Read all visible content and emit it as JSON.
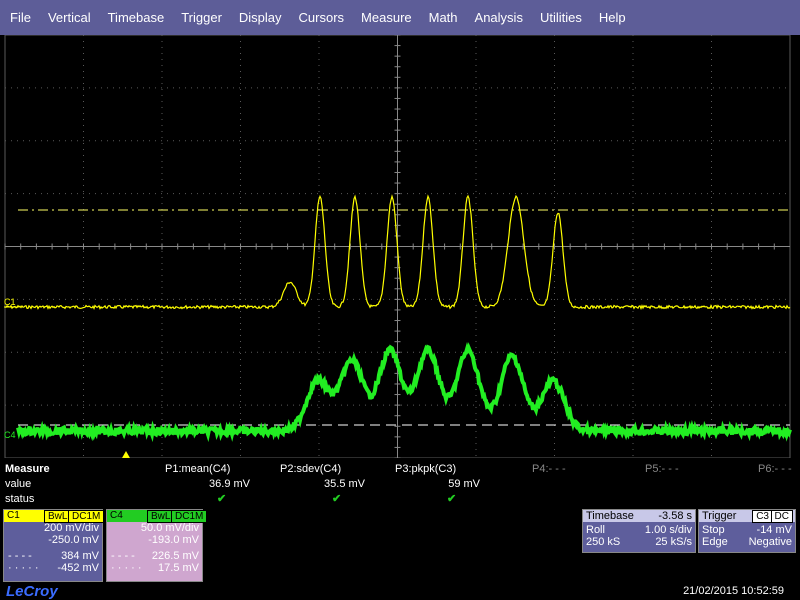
{
  "menu": [
    "File",
    "Vertical",
    "Timebase",
    "Trigger",
    "Display",
    "Cursors",
    "Measure",
    "Math",
    "Analysis",
    "Utilities",
    "Help"
  ],
  "markers": {
    "c1": "C1",
    "c4": "C4"
  },
  "colors": {
    "menu": "#5d5d98",
    "c1": "#ffff00",
    "c4": "#22ee22",
    "grid": "#666666"
  },
  "measure": {
    "title": "Measure",
    "row_value": "value",
    "row_status": "status",
    "params": [
      {
        "label": "P1:mean(C4)",
        "value": "36.9 mV",
        "ok": true
      },
      {
        "label": "P2:sdev(C4)",
        "value": "35.5 mV",
        "ok": true
      },
      {
        "label": "P3:pkpk(C3)",
        "value": "59 mV",
        "ok": true
      },
      {
        "label": "P4:- - -",
        "value": "",
        "ok": false
      },
      {
        "label": "P5:- - -",
        "value": "",
        "ok": false
      },
      {
        "label": "P6:- - -",
        "value": "",
        "ok": false
      }
    ]
  },
  "c1_panel": {
    "name": "C1",
    "tag1": "BwL",
    "tag2": "DC1M",
    "vdiv": "200 mV/div",
    "offset": "-250.0 mV",
    "cur1": "384 mV",
    "cur2": "-452 mV"
  },
  "c4_panel": {
    "name": "C4",
    "tag1": "BwL",
    "tag2": "DC1M",
    "vdiv": "50.0 mV/div",
    "offset": "-193.0 mV",
    "cur1": "226.5 mV",
    "cur2": "17.5 mV"
  },
  "timebase": {
    "label": "Timebase",
    "delay": "-3.58 s",
    "mode": "Roll",
    "tdiv": "1.00 s/div",
    "samples": "250 kS",
    "rate": "25 kS/s"
  },
  "trigger": {
    "label": "Trigger",
    "source": "C3",
    "coupling": "DC",
    "mode": "Stop",
    "level": "-14 mV",
    "type": "Edge",
    "slope": "Negative"
  },
  "brand": "LeCroy",
  "datetime": "21/02/2015 10:52:59"
}
